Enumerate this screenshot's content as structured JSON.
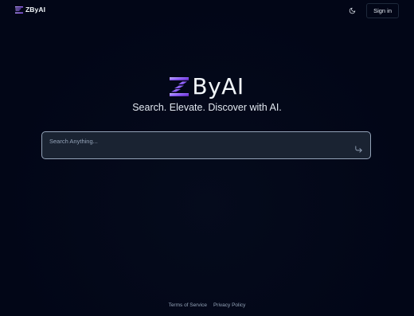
{
  "header": {
    "brand_name": "ZByAI",
    "signin_label": "Sign in",
    "theme_icon": "moon-icon"
  },
  "hero": {
    "logo_text": "ByAI",
    "tagline": "Search. Elevate. Discover with AI."
  },
  "search": {
    "placeholder": "Search Anything...",
    "value": "",
    "submit_icon": "arrow-forward-icon"
  },
  "footer": {
    "links": [
      {
        "label": "Terms of Service"
      },
      {
        "label": "Privacy Policy"
      }
    ]
  },
  "colors": {
    "background": "#020617",
    "brand_purple": "#a78bfa",
    "brand_purple_dark": "#6d28d9",
    "search_bg": "#1a2332",
    "search_border": "#94a3b8"
  }
}
